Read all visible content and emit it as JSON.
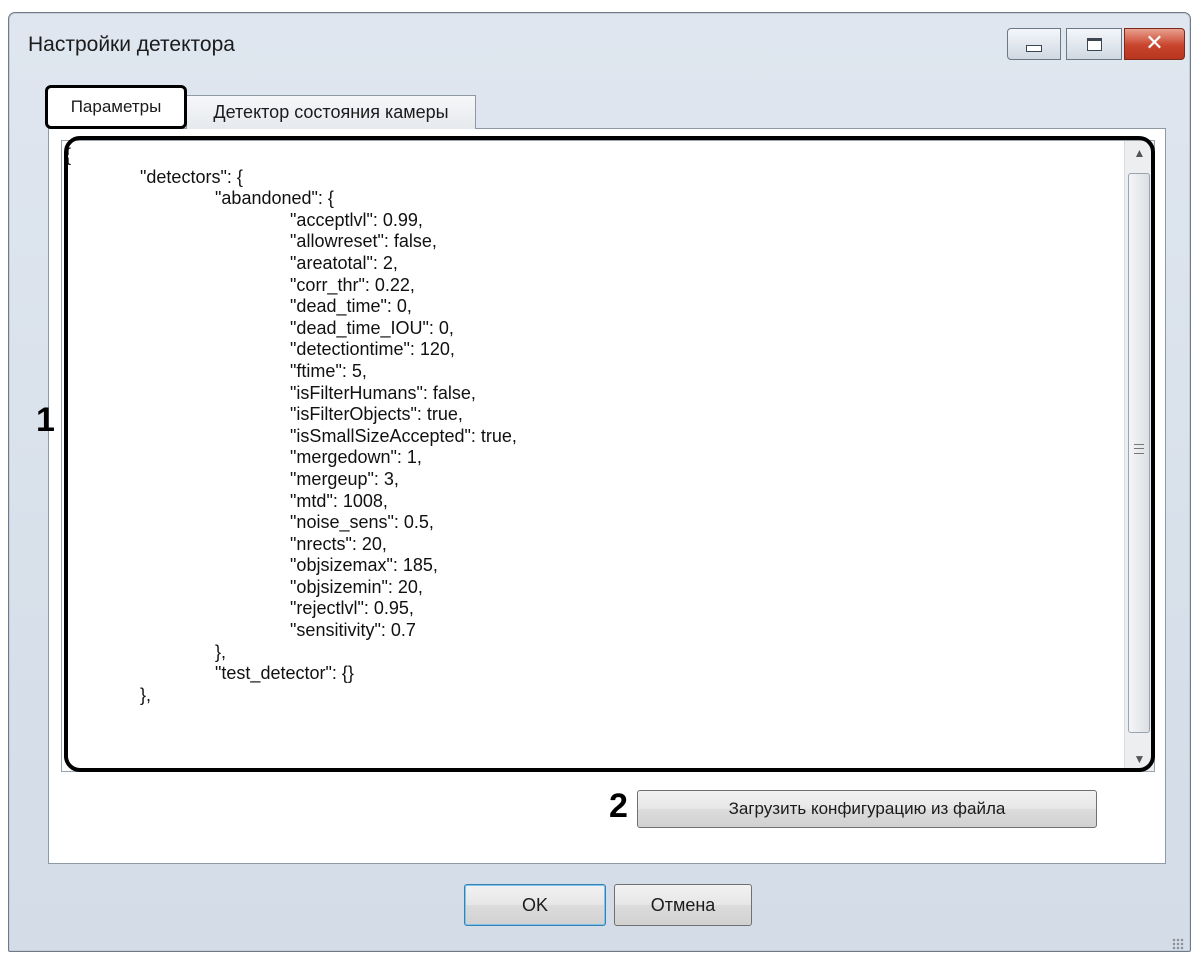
{
  "window": {
    "title": "Настройки детектора",
    "controls": {
      "minimize_icon": "minimize-icon",
      "maximize_icon": "maximize-icon",
      "close_icon": "close-icon",
      "close_glyph": "✕",
      "close_color": "#c9442c"
    }
  },
  "tabs": [
    {
      "label": "Параметры",
      "active": true
    },
    {
      "label": "Детектор состояния камеры",
      "active": false
    }
  ],
  "json_editor": {
    "lines": [
      "{",
      "\t\"detectors\": {",
      "\t\t\"abandoned\": {",
      "\t\t\t\"acceptlvl\": 0.99,",
      "\t\t\t\"allowreset\": false,",
      "\t\t\t\"areatotal\": 2,",
      "\t\t\t\"corr_thr\": 0.22,",
      "\t\t\t\"dead_time\": 0,",
      "\t\t\t\"dead_time_IOU\": 0,",
      "\t\t\t\"detectiontime\": 120,",
      "\t\t\t\"ftime\": 5,",
      "\t\t\t\"isFilterHumans\": false,",
      "\t\t\t\"isFilterObjects\": true,",
      "\t\t\t\"isSmallSizeAccepted\": true,",
      "\t\t\t\"mergedown\": 1,",
      "\t\t\t\"mergeup\": 3,",
      "\t\t\t\"mtd\": 1008,",
      "\t\t\t\"noise_sens\": 0.5,",
      "\t\t\t\"nrects\": 20,",
      "\t\t\t\"objsizemax\": 185,",
      "\t\t\t\"objsizemin\": 20,",
      "\t\t\t\"rejectlvl\": 0.95,",
      "\t\t\t\"sensitivity\": 0.7",
      "\t\t},",
      "\t\t\"test_detector\": {}",
      "\t},"
    ],
    "scrollbar": {
      "up_arrow": "▲",
      "down_arrow": "▼"
    }
  },
  "annotations": {
    "marker_1": "1",
    "marker_2": "2"
  },
  "buttons": {
    "load_config": "Загрузить конфигурацию из файла",
    "ok": "OK",
    "cancel": "Отмена"
  },
  "colors": {
    "window_chrome": "#d3dce7",
    "highlight_border": "#000000",
    "close_button": "#c9442c"
  }
}
